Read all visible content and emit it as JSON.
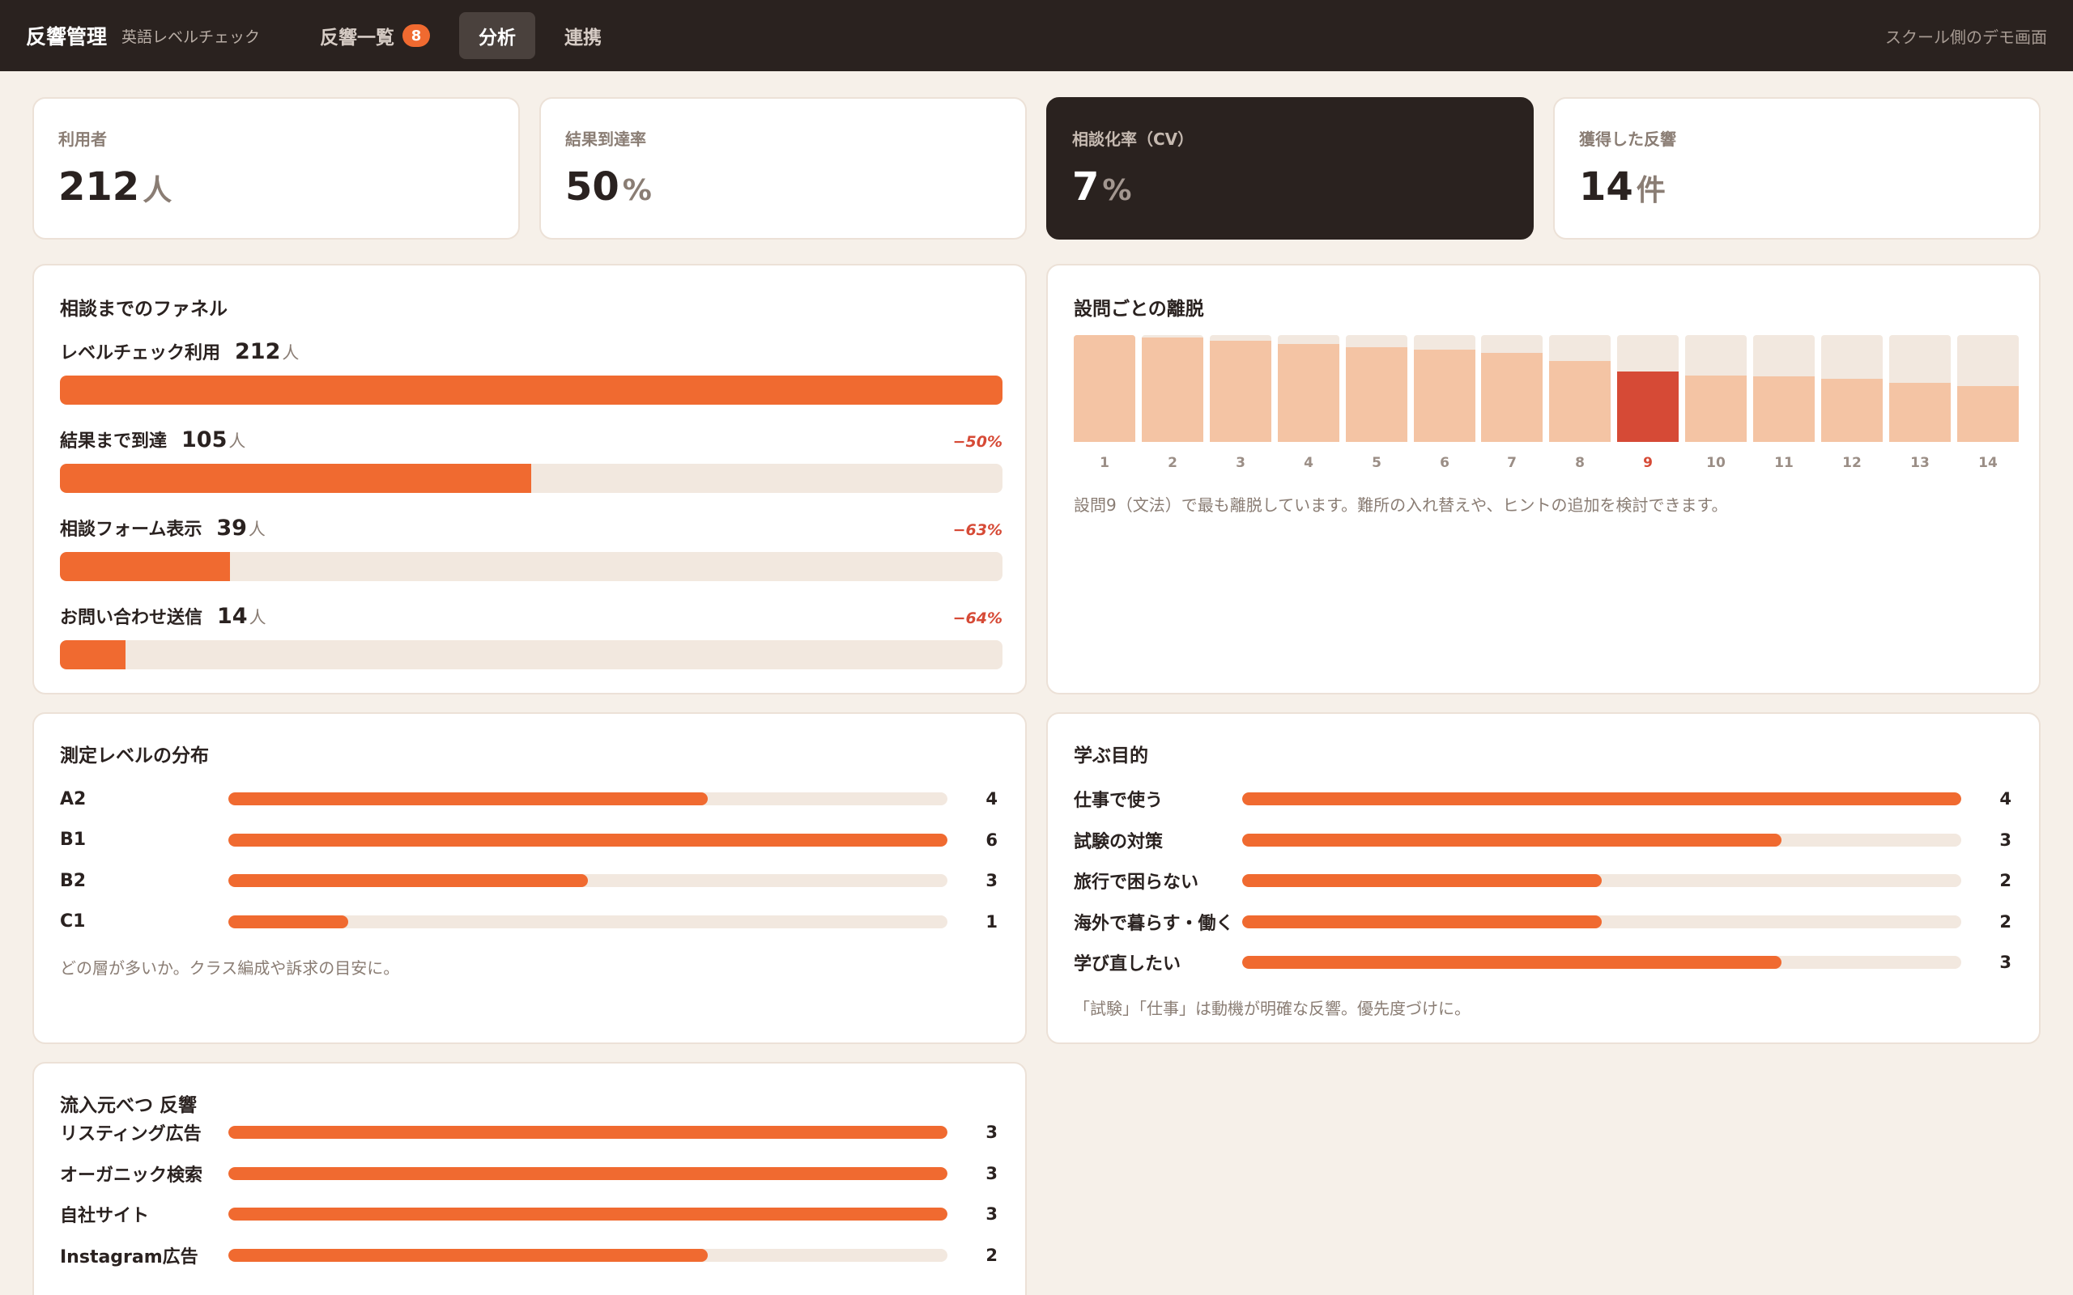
{
  "header": {
    "brand": "反響管理",
    "subtitle": "英語レベルチェック",
    "tabs": [
      {
        "label": "反響一覧",
        "badge": "8"
      },
      {
        "label": "分析"
      },
      {
        "label": "連携"
      }
    ],
    "right_text": "スクール側のデモ画面"
  },
  "stats": [
    {
      "label": "利用者",
      "value": "212",
      "unit": "人"
    },
    {
      "label": "結果到達率",
      "value": "50",
      "unit": "%"
    },
    {
      "label": "相談化率（CV）",
      "value": "7",
      "unit": "%"
    },
    {
      "label": "獲得した反響",
      "value": "14",
      "unit": "件"
    }
  ],
  "funnel": {
    "title": "相談までのファネル",
    "steps": [
      {
        "name": "レベルチェック利用",
        "count": "212",
        "unit": "人",
        "drop": "",
        "ratio": 1.0
      },
      {
        "name": "結果まで到達",
        "count": "105",
        "unit": "人",
        "drop": "−50%",
        "ratio": 0.5
      },
      {
        "name": "相談フォーム表示",
        "count": "39",
        "unit": "人",
        "drop": "−63%",
        "ratio": 0.18
      },
      {
        "name": "お問い合わせ送信",
        "count": "14",
        "unit": "人",
        "drop": "−64%",
        "ratio": 0.07
      }
    ]
  },
  "dropout": {
    "title": "設問ごとの離脱",
    "note": "設問9（文法）で最も離脱しています。難所の入れ替えや、ヒントの追加を検討できます。",
    "highlight": "9",
    "questions": [
      {
        "label": "1",
        "retention": 1.0
      },
      {
        "label": "2",
        "retention": 0.98
      },
      {
        "label": "3",
        "retention": 0.95
      },
      {
        "label": "4",
        "retention": 0.92
      },
      {
        "label": "5",
        "retention": 0.89
      },
      {
        "label": "6",
        "retention": 0.86
      },
      {
        "label": "7",
        "retention": 0.83
      },
      {
        "label": "8",
        "retention": 0.76
      },
      {
        "label": "9",
        "retention": 0.66
      },
      {
        "label": "10",
        "retention": 0.62
      },
      {
        "label": "11",
        "retention": 0.61
      },
      {
        "label": "12",
        "retention": 0.59
      },
      {
        "label": "13",
        "retention": 0.55
      },
      {
        "label": "14",
        "retention": 0.52
      }
    ]
  },
  "levels": {
    "title": "測定レベルの分布",
    "note": "どの層が多いか。クラス編成や訴求の目安に。",
    "max": 6,
    "items": [
      {
        "label": "A2",
        "value": "4"
      },
      {
        "label": "B1",
        "value": "6"
      },
      {
        "label": "B2",
        "value": "3"
      },
      {
        "label": "C1",
        "value": "1"
      }
    ]
  },
  "purposes": {
    "title": "学ぶ目的",
    "note": "「試験」「仕事」は動機が明確な反響。優先度づけに。",
    "max": 4,
    "items": [
      {
        "label": "仕事で使う",
        "value": "4"
      },
      {
        "label": "試験の対策",
        "value": "3"
      },
      {
        "label": "旅行で困らない",
        "value": "2"
      },
      {
        "label": "海外で暮らす・働く",
        "value": "2"
      },
      {
        "label": "学び直したい",
        "value": "3"
      }
    ]
  },
  "sources": {
    "title": "流入元べつ 反響",
    "max": 3,
    "items": [
      {
        "label": "リスティング広告",
        "value": "3"
      },
      {
        "label": "オーガニック検索",
        "value": "3"
      },
      {
        "label": "自社サイト",
        "value": "3"
      },
      {
        "label": "Instagram広告",
        "value": "2"
      }
    ]
  },
  "colors": {
    "accent": "#f06a30",
    "highlight": "#d64a36",
    "track": "#f2e8df",
    "dark": "#2a221f"
  }
}
